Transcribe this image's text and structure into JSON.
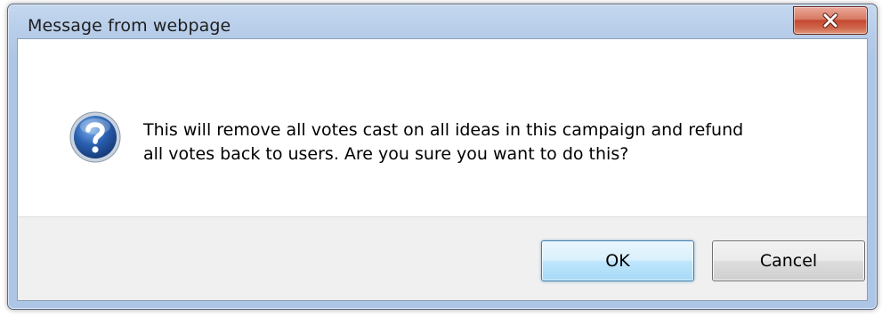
{
  "dialog": {
    "title": "Message from webpage",
    "close_icon": "close-icon",
    "message_icon": "question-icon",
    "message": "This will remove all votes cast on all ideas in this campaign and refund\nall votes back to users.  Are you sure you want to do this?",
    "ok_label": "OK",
    "cancel_label": "Cancel"
  },
  "colors": {
    "titlebar": "#b7cde9",
    "close_button": "#c4482f",
    "button_bar": "#f0f0f0",
    "default_button_border": "#3c7fb1",
    "question_icon": "#2a5fb0"
  }
}
